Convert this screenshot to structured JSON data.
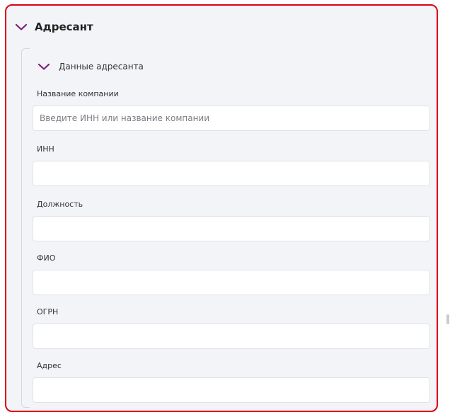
{
  "section": {
    "title": "Адресант"
  },
  "subsection": {
    "title": "Данные адресанта"
  },
  "fields": [
    {
      "label": "Название компании",
      "value": "",
      "placeholder": "Введите ИНН или название компании"
    },
    {
      "label": "ИНН",
      "value": "",
      "placeholder": ""
    },
    {
      "label": "Должность",
      "value": "",
      "placeholder": ""
    },
    {
      "label": "ФИО",
      "value": "",
      "placeholder": ""
    },
    {
      "label": "ОГРН",
      "value": "",
      "placeholder": ""
    },
    {
      "label": "Адрес",
      "value": "",
      "placeholder": ""
    }
  ],
  "icons": {
    "section_toggle": "chevron-down-icon",
    "subsection_toggle": "chevron-down-icon"
  },
  "colors": {
    "accent": "#7b1f7a",
    "highlight_border": "#d9001b",
    "panel_bg": "#f3f4f7"
  }
}
